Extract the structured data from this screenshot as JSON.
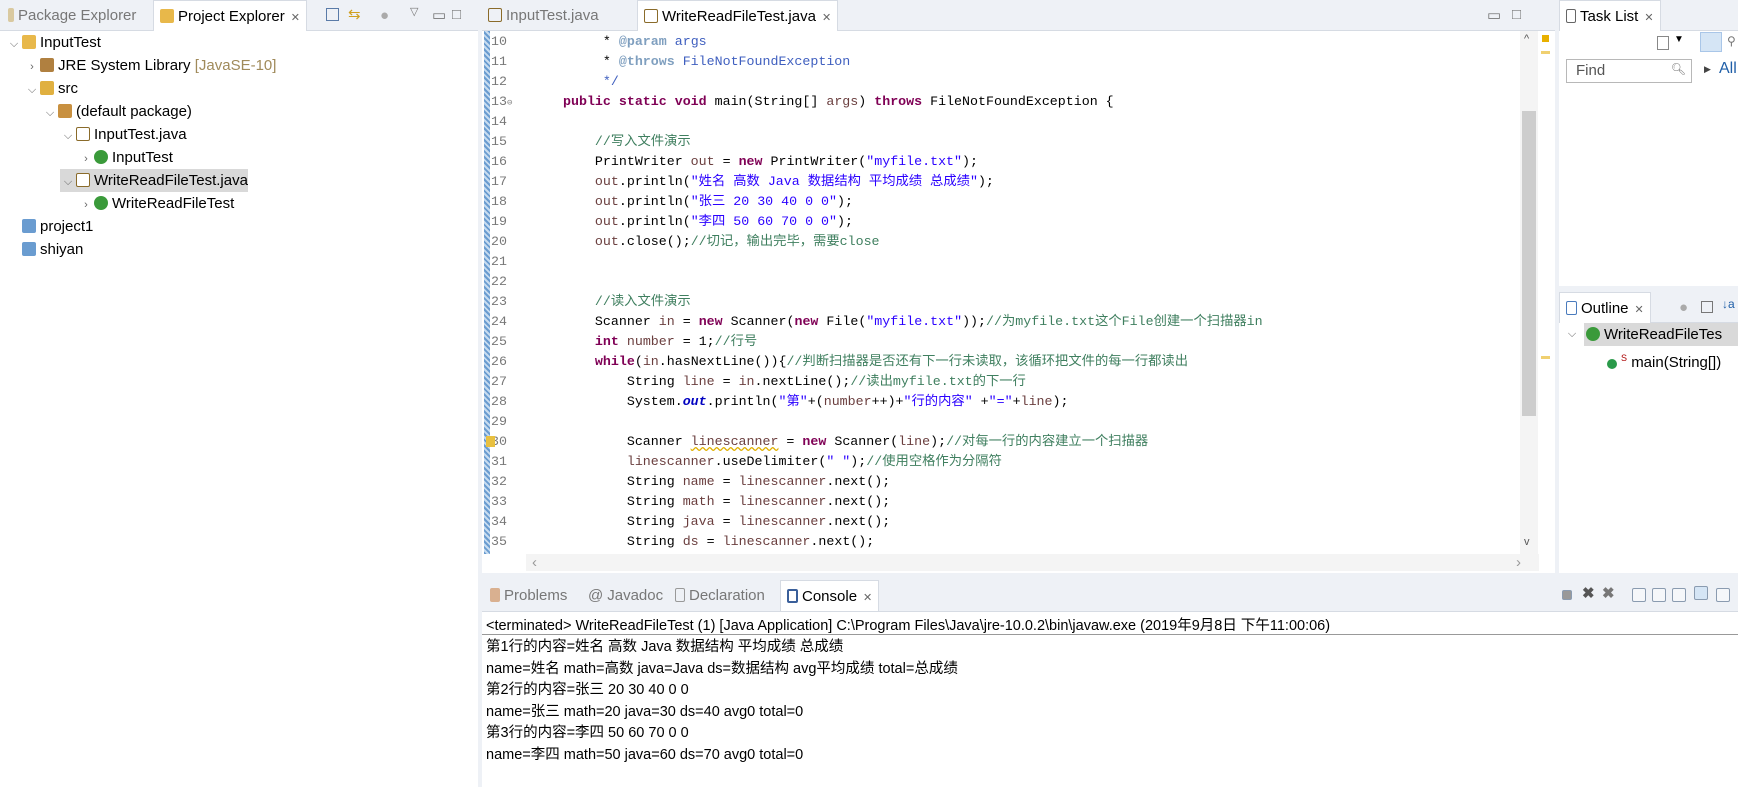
{
  "left_panel": {
    "tabs": [
      {
        "label": "Package Explorer",
        "active": false
      },
      {
        "label": "Project Explorer",
        "active": true
      }
    ],
    "tree": [
      {
        "label": "InputTest",
        "extra": "",
        "depth": 0,
        "chevron": "down",
        "icon": "java-project-icon"
      },
      {
        "label": "JRE System Library",
        "extra": "[JavaSE-10]",
        "depth": 1,
        "chevron": "right",
        "icon": "library-icon"
      },
      {
        "label": "src",
        "extra": "",
        "depth": 1,
        "chevron": "down",
        "icon": "source-folder-icon"
      },
      {
        "label": "(default package)",
        "extra": "",
        "depth": 2,
        "chevron": "down",
        "icon": "package-icon"
      },
      {
        "label": "InputTest.java",
        "extra": "",
        "depth": 3,
        "chevron": "down",
        "icon": "java-file-icon"
      },
      {
        "label": "InputTest",
        "extra": "",
        "depth": 4,
        "chevron": "right",
        "icon": "class-icon"
      },
      {
        "label": "WriteReadFileTest.java",
        "extra": "",
        "depth": 3,
        "chevron": "down",
        "icon": "java-file-icon",
        "selected": true
      },
      {
        "label": "WriteReadFileTest",
        "extra": "",
        "depth": 4,
        "chevron": "right",
        "icon": "class-icon"
      },
      {
        "label": "project1",
        "extra": "",
        "depth": 0,
        "chevron": "",
        "icon": "project-icon"
      },
      {
        "label": "shiyan",
        "extra": "",
        "depth": 0,
        "chevron": "",
        "icon": "project-icon"
      }
    ]
  },
  "editor": {
    "tabs": [
      {
        "label": "InputTest.java",
        "active": false
      },
      {
        "label": "WriteReadFileTest.java",
        "active": true
      }
    ],
    "lines": [
      {
        "n": "10",
        "t": [
          [
            "     * ",
            ""
          ],
          [
            "@param",
            "tag"
          ],
          [
            " args",
            "jd"
          ]
        ]
      },
      {
        "n": "11",
        "t": [
          [
            "     * ",
            ""
          ],
          [
            "@throws",
            "tag"
          ],
          [
            " FileNotFoundException",
            "jd"
          ]
        ]
      },
      {
        "n": "12",
        "t": [
          [
            "     */",
            "jd"
          ]
        ]
      },
      {
        "n": "13",
        "t": [
          [
            "public static void",
            "kw"
          ],
          [
            " main(String[] ",
            ""
          ],
          [
            "args",
            "var"
          ],
          [
            ") ",
            ""
          ],
          [
            "throws",
            "kw"
          ],
          [
            " FileNotFoundException {",
            ""
          ]
        ]
      },
      {
        "n": "14",
        "t": []
      },
      {
        "n": "15",
        "t": [
          [
            "    ",
            ""
          ],
          [
            "//写入文件演示",
            "cm"
          ]
        ]
      },
      {
        "n": "16",
        "t": [
          [
            "    PrintWriter ",
            ""
          ],
          [
            "out",
            "var"
          ],
          [
            " = ",
            ""
          ],
          [
            "new",
            "kw"
          ],
          [
            " PrintWriter(",
            ""
          ],
          [
            "\"myfile.txt\"",
            "str"
          ],
          [
            ");",
            ""
          ]
        ]
      },
      {
        "n": "17",
        "t": [
          [
            "    ",
            ""
          ],
          [
            "out",
            "var"
          ],
          [
            ".println(",
            ""
          ],
          [
            "\"姓名 高数 Java 数据结构 平均成绩 总成绩\"",
            "str"
          ],
          [
            ");",
            ""
          ]
        ]
      },
      {
        "n": "18",
        "t": [
          [
            "    ",
            ""
          ],
          [
            "out",
            "var"
          ],
          [
            ".println(",
            ""
          ],
          [
            "\"张三 20 30 40 0 0\"",
            "str"
          ],
          [
            ");",
            ""
          ]
        ]
      },
      {
        "n": "19",
        "t": [
          [
            "    ",
            ""
          ],
          [
            "out",
            "var"
          ],
          [
            ".println(",
            ""
          ],
          [
            "\"李四 50 60 70 0 0\"",
            "str"
          ],
          [
            ");",
            ""
          ]
        ]
      },
      {
        "n": "20",
        "t": [
          [
            "    ",
            ""
          ],
          [
            "out",
            "var"
          ],
          [
            ".close();",
            ""
          ],
          [
            "//切记，输出完毕，需要close",
            "cm"
          ]
        ]
      },
      {
        "n": "21",
        "t": []
      },
      {
        "n": "22",
        "t": []
      },
      {
        "n": "23",
        "t": [
          [
            "    ",
            ""
          ],
          [
            "//读入文件演示",
            "cm"
          ]
        ]
      },
      {
        "n": "24",
        "t": [
          [
            "    Scanner ",
            ""
          ],
          [
            "in",
            "var"
          ],
          [
            " = ",
            ""
          ],
          [
            "new",
            "kw"
          ],
          [
            " Scanner(",
            ""
          ],
          [
            "new",
            "kw"
          ],
          [
            " File(",
            ""
          ],
          [
            "\"myfile.txt\"",
            "str"
          ],
          [
            "));",
            ""
          ],
          [
            "//为myfile.txt这个File创建一个扫描器in",
            "cm"
          ]
        ]
      },
      {
        "n": "25",
        "t": [
          [
            "    ",
            ""
          ],
          [
            "int",
            "kw"
          ],
          [
            " ",
            ""
          ],
          [
            "number",
            "var"
          ],
          [
            " = 1;",
            ""
          ],
          [
            "//行号",
            "cm"
          ]
        ]
      },
      {
        "n": "26",
        "t": [
          [
            "    ",
            ""
          ],
          [
            "while",
            "kw"
          ],
          [
            "(",
            ""
          ],
          [
            "in",
            "var"
          ],
          [
            ".hasNextLine()){",
            ""
          ],
          [
            "//判断扫描器是否还有下一行未读取，该循环把文件的每一行都读出",
            "cm"
          ]
        ]
      },
      {
        "n": "27",
        "t": [
          [
            "        String ",
            ""
          ],
          [
            "line",
            "var"
          ],
          [
            " = ",
            ""
          ],
          [
            "in",
            "var"
          ],
          [
            ".nextLine();",
            ""
          ],
          [
            "//读出myfile.txt的下一行",
            "cm"
          ]
        ]
      },
      {
        "n": "28",
        "t": [
          [
            "        System.",
            ""
          ],
          [
            "out",
            "fld"
          ],
          [
            ".println(",
            ""
          ],
          [
            "\"第\"",
            "str"
          ],
          [
            "+(",
            ""
          ],
          [
            "number",
            "var"
          ],
          [
            "++)+",
            ""
          ],
          [
            "\"行的内容\"",
            "str"
          ],
          [
            " +",
            ""
          ],
          [
            "\"=\"",
            "str"
          ],
          [
            "+",
            ""
          ],
          [
            "line",
            "var"
          ],
          [
            ");",
            ""
          ]
        ]
      },
      {
        "n": "29",
        "t": []
      },
      {
        "n": "30",
        "t": [
          [
            "        Scanner ",
            ""
          ],
          [
            "linescanner",
            "var warn"
          ],
          [
            " = ",
            ""
          ],
          [
            "new",
            "kw"
          ],
          [
            " Scanner(",
            ""
          ],
          [
            "line",
            "var"
          ],
          [
            ");",
            ""
          ],
          [
            "//对每一行的内容建立一个扫描器",
            "cm"
          ]
        ],
        "warning": true
      },
      {
        "n": "31",
        "t": [
          [
            "        ",
            ""
          ],
          [
            "linescanner",
            "var"
          ],
          [
            ".useDelimiter(",
            ""
          ],
          [
            "\" \"",
            "str"
          ],
          [
            ");",
            ""
          ],
          [
            "//使用空格作为分隔符",
            "cm"
          ]
        ]
      },
      {
        "n": "32",
        "t": [
          [
            "        String ",
            ""
          ],
          [
            "name",
            "var"
          ],
          [
            " = ",
            ""
          ],
          [
            "linescanner",
            "var"
          ],
          [
            ".next();",
            ""
          ]
        ]
      },
      {
        "n": "33",
        "t": [
          [
            "        String ",
            ""
          ],
          [
            "math",
            "var"
          ],
          [
            " = ",
            ""
          ],
          [
            "linescanner",
            "var"
          ],
          [
            ".next();",
            ""
          ]
        ]
      },
      {
        "n": "34",
        "t": [
          [
            "        String ",
            ""
          ],
          [
            "java",
            "var"
          ],
          [
            " = ",
            ""
          ],
          [
            "linescanner",
            "var"
          ],
          [
            ".next();",
            ""
          ]
        ]
      },
      {
        "n": "35",
        "t": [
          [
            "        String ",
            ""
          ],
          [
            "ds",
            "var"
          ],
          [
            " = ",
            ""
          ],
          [
            "linescanner",
            "var"
          ],
          [
            ".next();",
            ""
          ]
        ]
      }
    ]
  },
  "right_panel": {
    "task_list": {
      "label": "Task List",
      "find_placeholder": "Find",
      "all_label": "All"
    },
    "outline": {
      "label": "Outline",
      "class_name": "WriteReadFileTes",
      "method": "main(String[])"
    }
  },
  "bottom_panel": {
    "tabs": [
      {
        "label": "Problems",
        "active": false
      },
      {
        "label": "Javadoc",
        "active": false
      },
      {
        "label": "Declaration",
        "active": false
      },
      {
        "label": "Console",
        "active": true
      }
    ],
    "console_header": "<terminated> WriteReadFileTest (1) [Java Application] C:\\Program Files\\Java\\jre-10.0.2\\bin\\javaw.exe (2019年9月8日 下午11:00:06)",
    "output": [
      "第1行的内容=姓名 高数 Java 数据结构 平均成绩 总成绩",
      "name=姓名 math=高数 java=Java ds=数据结构 avg平均成绩 total=总成绩",
      "第2行的内容=张三 20 30 40 0 0",
      "name=张三 math=20 java=30 ds=40 avg0 total=0",
      "第3行的内容=李四 50 60 70 0 0",
      "name=李四 math=50 java=60 ds=70 avg0 total=0"
    ]
  }
}
